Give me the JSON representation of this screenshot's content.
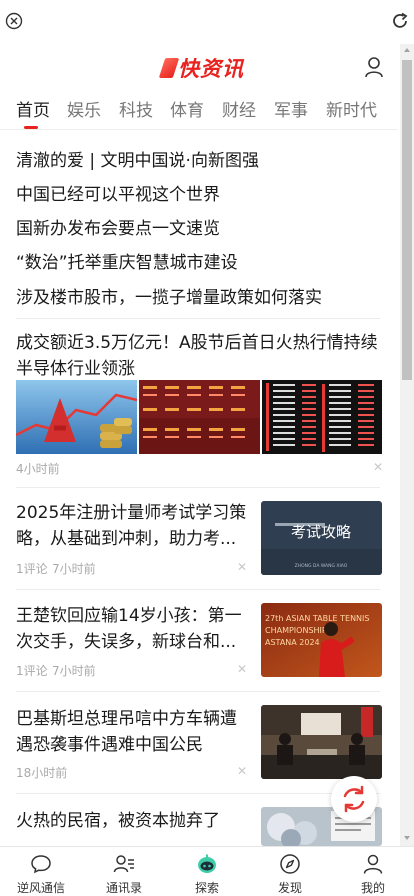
{
  "browser": {
    "close_icon": "close-circle-icon",
    "refresh_icon": "refresh-icon"
  },
  "header": {
    "logo_text": "快资讯",
    "user_icon": "user-icon",
    "brand_color": "#e8231f"
  },
  "tabs": [
    {
      "label": "首页",
      "active": true
    },
    {
      "label": "娱乐"
    },
    {
      "label": "科技"
    },
    {
      "label": "体育"
    },
    {
      "label": "财经"
    },
    {
      "label": "军事"
    },
    {
      "label": "新时代"
    }
  ],
  "headlines": [
    "清澈的爱 | 文明中国说·向新图强",
    "中国已经可以平视这个世界",
    "国新办发布会要点一文速览",
    "“数治”托举重庆智慧城市建设",
    "涉及楼市股市，一揽子增量政策如何落实"
  ],
  "feature": {
    "title": "成交额近3.5万亿元！A股节后首日火热行情持续 半导体行业领涨",
    "time": "4小时前"
  },
  "articles": [
    {
      "title": "2025年注册计量师考试学习策略，从基础到冲刺，助力考...",
      "comments": "1评论",
      "time": "7小时前",
      "image_text": "考试攻略",
      "image_sub": "ZHONG DA WANG XIAO"
    },
    {
      "title": "王楚钦回应输14岁小孩：第一次交手，失误多，新球台和...",
      "comments": "1评论",
      "time": "7小时前",
      "image_text": "27th ASIAN TABLE TENNIS CHAMPIONSHIPS ASTANA 2024"
    },
    {
      "title": "巴基斯坦总理吊唁中方车辆遭遇恐袭事件遇难中国公民",
      "time": "18小时前"
    },
    {
      "title": "火热的民宿，被资本抛弃了"
    }
  ],
  "bottom_nav": [
    {
      "label": "逆风通信",
      "icon": "chat-bubble-icon"
    },
    {
      "label": "通讯录",
      "icon": "contacts-icon"
    },
    {
      "label": "探索",
      "icon": "explore-robot-icon"
    },
    {
      "label": "发现",
      "icon": "compass-icon"
    },
    {
      "label": "我的",
      "icon": "profile-icon"
    }
  ]
}
